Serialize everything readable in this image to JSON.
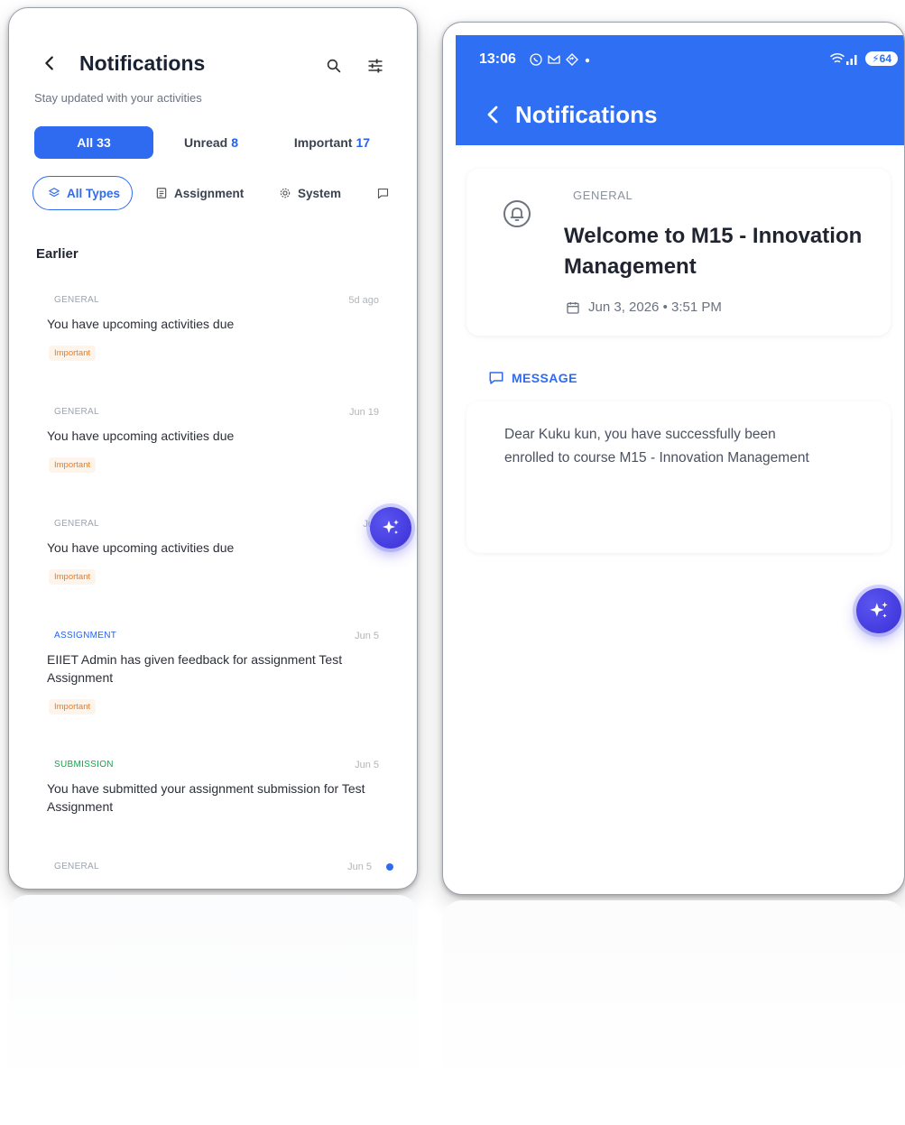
{
  "left_screen": {
    "title": "Notifications",
    "subtitle": "Stay updated with your activities",
    "tabs": [
      {
        "label": "All",
        "count": "33"
      },
      {
        "label": "Unread",
        "count": "8"
      },
      {
        "label": "Important",
        "count": "17"
      }
    ],
    "chips": [
      {
        "label": "All Types",
        "icon": "layers-icon"
      },
      {
        "label": "Assignment",
        "icon": "clipboard-icon"
      },
      {
        "label": "System",
        "icon": "gear-icon"
      },
      {
        "label": "",
        "icon": "chat-icon"
      }
    ],
    "section": "Earlier",
    "notifications": [
      {
        "type": "GENERAL",
        "date": "5d ago",
        "title": "You have upcoming activities due",
        "badge": "Important"
      },
      {
        "type": "GENERAL",
        "date": "Jun 19",
        "title": "You have upcoming activities due",
        "badge": "Important"
      },
      {
        "type": "GENERAL",
        "date": "Jun",
        "title": "You have upcoming activities due",
        "badge": "Important"
      },
      {
        "type": "ASSIGNMENT",
        "date": "Jun 5",
        "title": "EIIET Admin has given feedback for assignment Test Assignment",
        "badge": "Important"
      },
      {
        "type": "SUBMISSION",
        "date": "Jun 5",
        "title": "You have submitted your assignment submission for Test Assignment",
        "badge": ""
      },
      {
        "type": "GENERAL",
        "date": "Jun 5",
        "title": "",
        "badge": ""
      }
    ]
  },
  "right_screen": {
    "status_bar": {
      "time": "13:06",
      "battery": "64"
    },
    "title": "Notifications",
    "detail": {
      "type": "GENERAL",
      "heading": "Welcome to M15 - Innovation Management",
      "date": "Jun 3, 2026 • 3:51 PM"
    },
    "message_label": "MESSAGE",
    "message_body": "Dear Kuku kun, you have successfully been enrolled to course M15 - Innovation Management"
  },
  "colors": {
    "primary": "#2f6bf0",
    "important": "#ea7b25",
    "submission": "#16a34a",
    "fab": "#4338ca"
  }
}
